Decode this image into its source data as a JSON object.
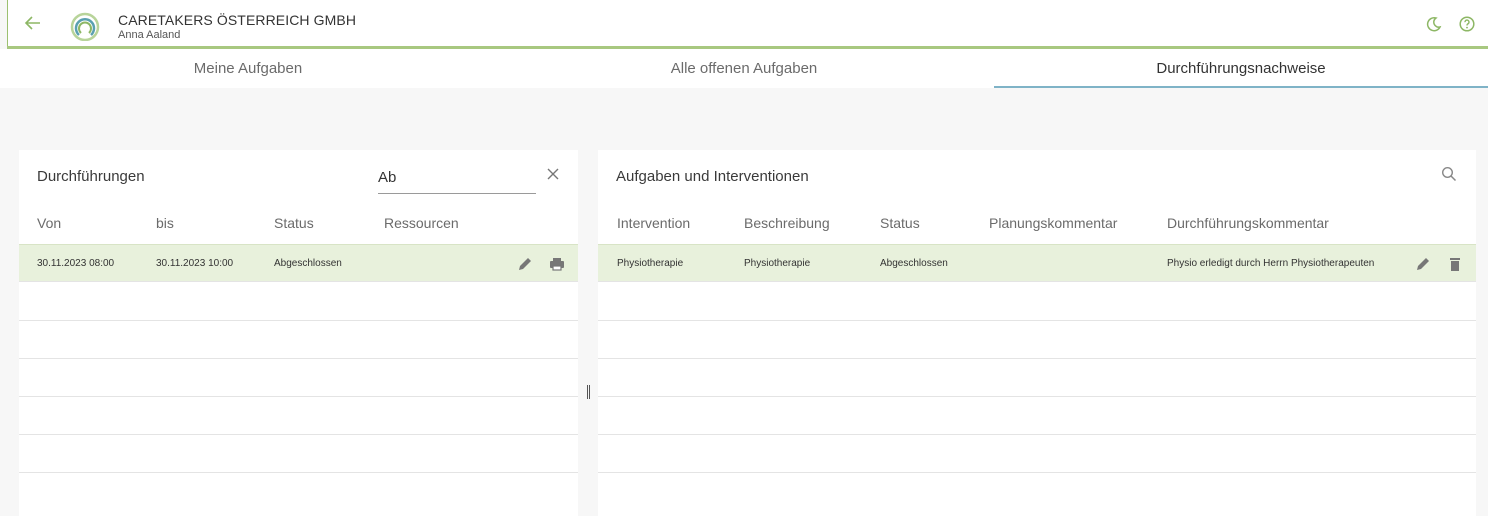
{
  "header": {
    "org_name": "CARETAKERS ÖSTERREICH GMBH",
    "user_name": "Anna Aaland",
    "icons": [
      "back-arrow-icon",
      "logo",
      "moon-icon",
      "help-icon"
    ],
    "accent_color": "#8db765"
  },
  "tabs": [
    {
      "label": "Meine Aufgaben",
      "active": false
    },
    {
      "label": "Alle offenen Aufgaben",
      "active": false
    },
    {
      "label": "Durchführungsnachweise",
      "active": true
    }
  ],
  "left_panel": {
    "title": "Durchführungen",
    "search_value": "Ab",
    "columns": [
      "Von",
      "bis",
      "Status",
      "Ressourcen"
    ],
    "rows": [
      {
        "von": "30.11.2023 08:00",
        "bis": "30.11.2023 10:00",
        "status": "Abgeschlossen",
        "ressourcen": ""
      }
    ]
  },
  "right_panel": {
    "title": "Aufgaben und Interventionen",
    "columns": [
      "Intervention",
      "Beschreibung",
      "Status",
      "Planungskommentar",
      "Durchführungskommentar"
    ],
    "rows": [
      {
        "intervention": "Physiotherapie",
        "beschreibung": "Physiotherapie",
        "status": "Abgeschlossen",
        "planungskommentar": "",
        "durchfuehrungskommentar": "Physio erledigt durch Herrn Physiotherapeuten"
      }
    ]
  },
  "colors": {
    "selected_row": "#e8f1dc",
    "tab_underline": "#7fb3c7",
    "header_border": "#a8c880"
  }
}
